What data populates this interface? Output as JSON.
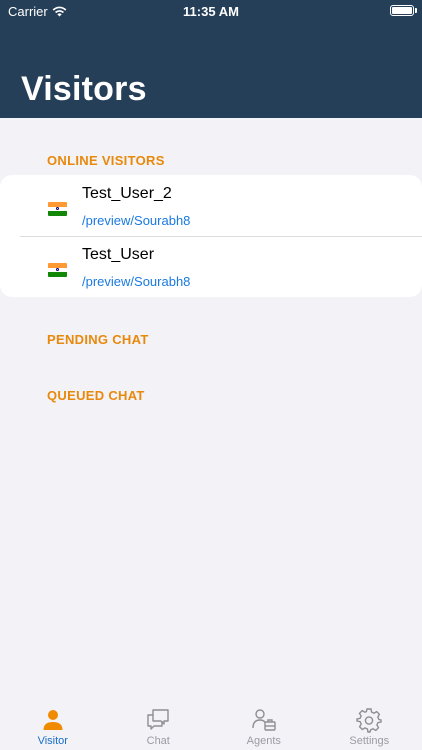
{
  "status_bar": {
    "carrier": "Carrier",
    "time": "11:35 AM"
  },
  "header": {
    "title": "Visitors"
  },
  "sections": {
    "online": "ONLINE VISITORS",
    "pending": "PENDING CHAT",
    "queued": "QUEUED CHAT"
  },
  "visitors": [
    {
      "name": "Test_User_2",
      "path": "/preview/Sourabh8",
      "flag": "india-flag-icon"
    },
    {
      "name": "Test_User",
      "path": "/preview/Sourabh8",
      "flag": "india-flag-icon"
    }
  ],
  "tabs": [
    {
      "label": "Visitor",
      "icon": "person-icon",
      "active": true
    },
    {
      "label": "Chat",
      "icon": "chat-bubbles-icon",
      "active": false
    },
    {
      "label": "Agents",
      "icon": "agents-icon",
      "active": false
    },
    {
      "label": "Settings",
      "icon": "gear-icon",
      "active": false
    }
  ],
  "colors": {
    "header_bg": "#263f58",
    "section_accent": "#e8890c",
    "link": "#1a7ae0",
    "tab_active_icon": "#f08a00",
    "tab_active_label": "#1a6fc7",
    "tab_inactive": "#9b9ba2"
  }
}
